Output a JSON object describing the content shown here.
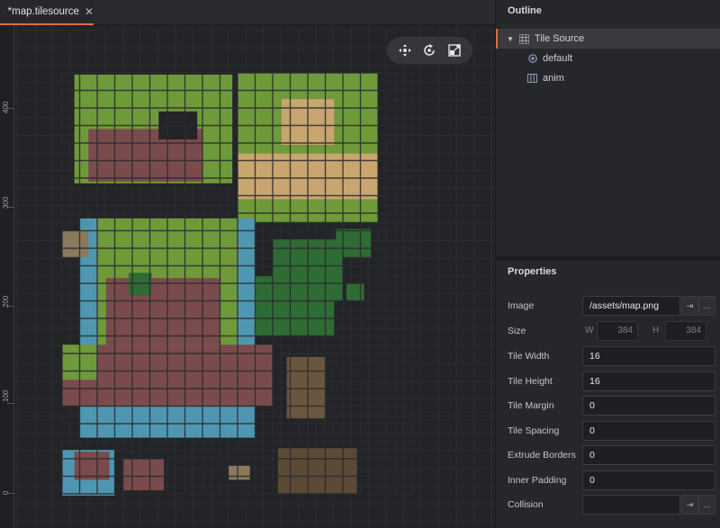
{
  "editor": {
    "tab_title": "*map.tilesource",
    "tab_close": "✕",
    "ruler_labels": [
      "400",
      "300",
      "200",
      "100",
      "0"
    ],
    "toolbar": {
      "icons": [
        "move-icon",
        "rotate-icon",
        "scale-icon"
      ]
    }
  },
  "outline": {
    "title": "Outline",
    "items": [
      {
        "label": "Tile Source",
        "icon": "tilesource-grid-icon",
        "expanded": true,
        "selected": true
      },
      {
        "label": "default",
        "icon": "collision-group-icon"
      },
      {
        "label": "anim",
        "icon": "animation-icon"
      }
    ]
  },
  "properties": {
    "title": "Properties",
    "image": {
      "label": "Image",
      "value": "/assets/map.png",
      "btn_goto": "⇥",
      "btn_browse": "…"
    },
    "size": {
      "label": "Size",
      "w_label": "W",
      "w_value": "384",
      "h_label": "H",
      "h_value": "384"
    },
    "tile_width": {
      "label": "Tile Width",
      "value": "16"
    },
    "tile_height": {
      "label": "Tile Height",
      "value": "16"
    },
    "tile_margin": {
      "label": "Tile Margin",
      "value": "0"
    },
    "tile_spacing": {
      "label": "Tile Spacing",
      "value": "0"
    },
    "extrude_borders": {
      "label": "Extrude Borders",
      "value": "0"
    },
    "inner_padding": {
      "label": "Inner Padding",
      "value": "0"
    },
    "collision": {
      "label": "Collision",
      "value": "",
      "btn_goto": "⇥",
      "btn_browse": "…"
    }
  },
  "colors": {
    "accent": "#e06b3e",
    "grass": "#6e9a3a",
    "water": "#4f97b1",
    "dirt": "#c9a56f",
    "rock": "#7a4b4c",
    "tree": "#2f6b34"
  }
}
